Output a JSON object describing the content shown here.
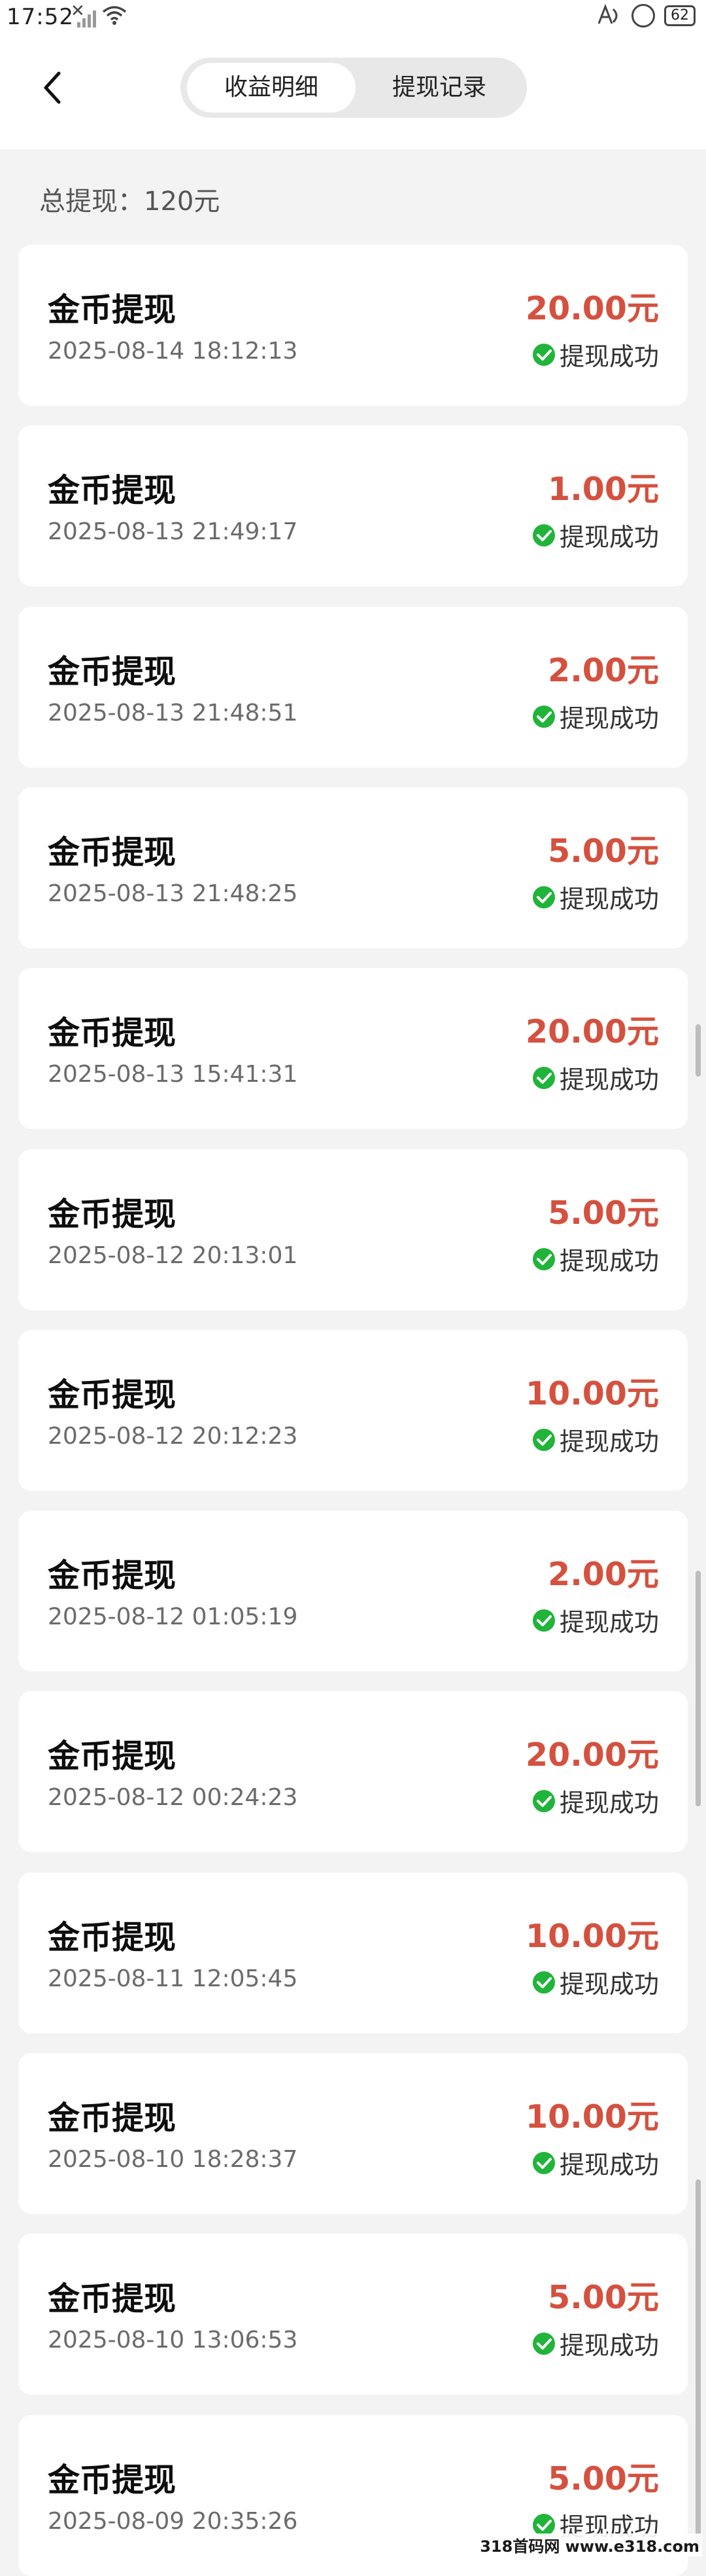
{
  "status_bar": {
    "time": "17:52",
    "mini": "✕",
    "battery": "62"
  },
  "header": {
    "tabs": [
      "收益明细",
      "提现记录"
    ]
  },
  "summary": {
    "total_label": "总提现：120元"
  },
  "records": [
    {
      "title": "金币提现",
      "time": "2025-08-14 18:12:13",
      "amount": "20.00元",
      "status": "提现成功"
    },
    {
      "title": "金币提现",
      "time": "2025-08-13 21:49:17",
      "amount": "1.00元",
      "status": "提现成功"
    },
    {
      "title": "金币提现",
      "time": "2025-08-13 21:48:51",
      "amount": "2.00元",
      "status": "提现成功"
    },
    {
      "title": "金币提现",
      "time": "2025-08-13 21:48:25",
      "amount": "5.00元",
      "status": "提现成功"
    },
    {
      "title": "金币提现",
      "time": "2025-08-13 15:41:31",
      "amount": "20.00元",
      "status": "提现成功"
    },
    {
      "title": "金币提现",
      "time": "2025-08-12 20:13:01",
      "amount": "5.00元",
      "status": "提现成功"
    },
    {
      "title": "金币提现",
      "time": "2025-08-12 20:12:23",
      "amount": "10.00元",
      "status": "提现成功"
    },
    {
      "title": "金币提现",
      "time": "2025-08-12 01:05:19",
      "amount": "2.00元",
      "status": "提现成功"
    },
    {
      "title": "金币提现",
      "time": "2025-08-12 00:24:23",
      "amount": "20.00元",
      "status": "提现成功"
    },
    {
      "title": "金币提现",
      "time": "2025-08-11 12:05:45",
      "amount": "10.00元",
      "status": "提现成功"
    },
    {
      "title": "金币提现",
      "time": "2025-08-10 18:28:37",
      "amount": "10.00元",
      "status": "提现成功"
    },
    {
      "title": "金币提现",
      "time": "2025-08-10 13:06:53",
      "amount": "5.00元",
      "status": "提现成功"
    },
    {
      "title": "金币提现",
      "time": "2025-08-09 20:35:26",
      "amount": "5.00元",
      "status": "提现成功"
    }
  ],
  "colors": {
    "amount": "#d4513f",
    "success": "#21b43a",
    "background": "#f3f3f3"
  },
  "watermark": "318首码网 www.e318.com"
}
